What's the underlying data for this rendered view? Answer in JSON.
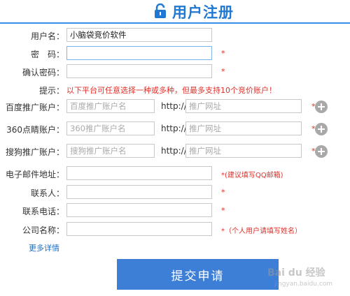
{
  "header": {
    "title": "用户注册",
    "icon": "lock-icon",
    "accent": "#1f78d1"
  },
  "form": {
    "username": {
      "label": "用户名：",
      "value": "小脑袋竞价软件"
    },
    "password": {
      "label": "密　码：",
      "required": "*"
    },
    "confirm": {
      "label": "确认密码：",
      "required": "*"
    },
    "tip": {
      "label": "提示：",
      "text": "以下平台可任意选择一种或多种，但最多支持10个竞价账户！"
    },
    "baidu": {
      "label": "百度推广账户：",
      "placeholder": "百度推广账户名",
      "http": "http://",
      "url_placeholder": "推广网址",
      "required": "*"
    },
    "s360": {
      "label": "360点睛账户：",
      "placeholder": "360推广账户名",
      "http": "http://",
      "url_placeholder": "推广网址",
      "required": "*"
    },
    "sogou": {
      "label": "搜狗推广账户：",
      "placeholder": "搜狗推广账户名",
      "http": "http://",
      "url_placeholder": "推广网址",
      "required": "*"
    },
    "email": {
      "label": "电子邮件地址：",
      "hint": "*(建议填写QQ邮箱)"
    },
    "contact": {
      "label": "联系人：",
      "required": "*"
    },
    "phone": {
      "label": "联系电话：",
      "required": "*"
    },
    "company": {
      "label": "公司名称：",
      "hint": "*（个人用户请填写姓名）"
    },
    "more": "更多详情",
    "submit": "提交申请"
  },
  "watermark": {
    "main": "Bai du 经验",
    "sub": "jingyan.baidu.com"
  },
  "colors": {
    "required": "#e0302a",
    "button": "#3d7fd6",
    "link": "#1f6fc4"
  }
}
